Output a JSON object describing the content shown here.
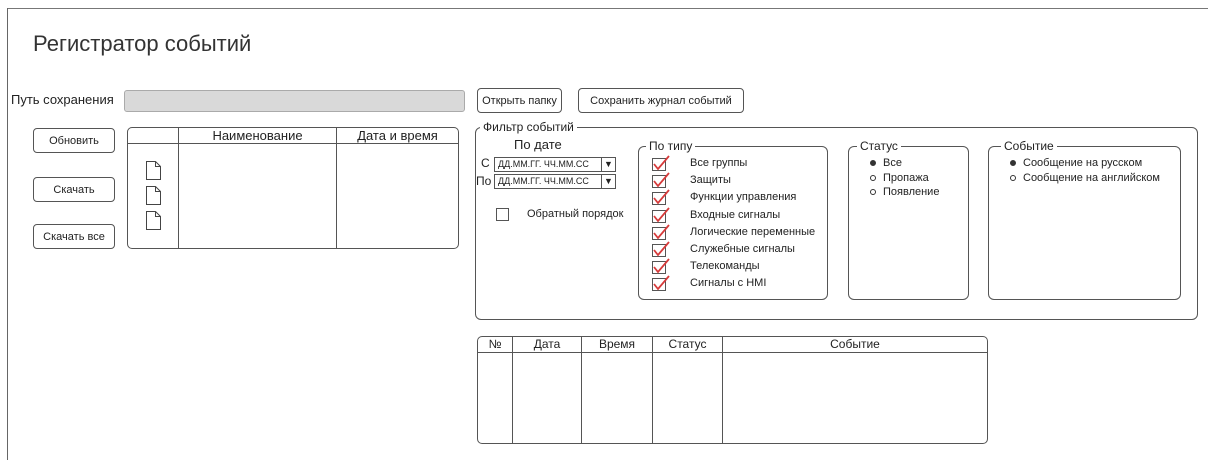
{
  "title": "Регистратор событий",
  "path": {
    "label": "Путь сохранения",
    "value": "",
    "open_folder_button": "Открыть папку",
    "save_log_button": "Сохранить журнал событий"
  },
  "files": {
    "refresh_button": "Обновить",
    "download_button": "Скачать",
    "download_all_button": "Скачать все",
    "columns": [
      "",
      "Наименование",
      "Дата и время"
    ],
    "rows": [
      {
        "icon": "file-icon",
        "name": "",
        "datetime": ""
      },
      {
        "icon": "file-icon",
        "name": "",
        "datetime": ""
      },
      {
        "icon": "file-icon",
        "name": "",
        "datetime": ""
      }
    ]
  },
  "filter": {
    "title": "Фильтр событий",
    "by_date": {
      "title": "По дате",
      "from_label": "С",
      "from_value": "ДД.ММ.ГГ. ЧЧ.ММ.СС",
      "to_label": "По",
      "to_value": "ДД.ММ.ГГ. ЧЧ.ММ.СС",
      "reverse_order_label": "Обратный порядок",
      "reverse_order_checked": false
    },
    "by_type": {
      "title": "По типу",
      "items": [
        {
          "label": "Все группы",
          "checked": true
        },
        {
          "label": "Защиты",
          "checked": true
        },
        {
          "label": "Функции управления",
          "checked": true
        },
        {
          "label": "Входные сигналы",
          "checked": true
        },
        {
          "label": "Логические переменные",
          "checked": true
        },
        {
          "label": "Служебные сигналы",
          "checked": true
        },
        {
          "label": "Телекоманды",
          "checked": true
        },
        {
          "label": "Сигналы с HMI",
          "checked": true
        }
      ]
    },
    "status": {
      "title": "Статус",
      "options": [
        {
          "label": "Все",
          "selected": true
        },
        {
          "label": "Пропажа",
          "selected": false
        },
        {
          "label": "Появление",
          "selected": false
        }
      ]
    },
    "event": {
      "title": "Событие",
      "options": [
        {
          "label": "Сообщение на русском",
          "selected": true
        },
        {
          "label": "Сообщение на английском",
          "selected": false
        }
      ]
    }
  },
  "events_table": {
    "columns": [
      "№",
      "Дата",
      "Время",
      "Статус",
      "Событие"
    ]
  },
  "colors": {
    "check_red": "#d63a3a",
    "input_gray": "#d9d9d9",
    "border": "#555555"
  }
}
